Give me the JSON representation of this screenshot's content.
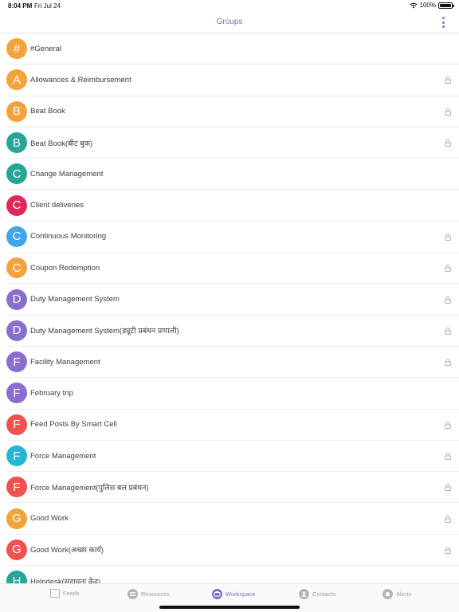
{
  "status_bar": {
    "time": "8:04 PM",
    "date": "Fri Jul 24",
    "battery": "100%"
  },
  "nav": {
    "title": "Groups",
    "more_icon": "vertical-ellipsis-icon"
  },
  "groups": [
    {
      "initial": "#",
      "name": "#General",
      "color": "#f2a33c",
      "locked": false
    },
    {
      "initial": "A",
      "name": "Allowances & Reimbursement",
      "color": "#f2a33c",
      "locked": true
    },
    {
      "initial": "B",
      "name": "Beat Book",
      "color": "#f2a33c",
      "locked": true
    },
    {
      "initial": "B",
      "name": "Beat Book(बीट बुक)",
      "color": "#27a596",
      "locked": true
    },
    {
      "initial": "C",
      "name": "Change Management",
      "color": "#27a596",
      "locked": false
    },
    {
      "initial": "C",
      "name": "Client deliveries",
      "color": "#e0295a",
      "locked": false
    },
    {
      "initial": "C",
      "name": "Continuous Monitoring",
      "color": "#42a4ea",
      "locked": true
    },
    {
      "initial": "C",
      "name": "Coupon Redemption",
      "color": "#f2a33c",
      "locked": true
    },
    {
      "initial": "D",
      "name": "Duty Management System",
      "color": "#8a6ecf",
      "locked": true
    },
    {
      "initial": "D",
      "name": "Duty Management System(ड्यूटी प्रबंधन प्रणाली)",
      "color": "#8a6ecf",
      "locked": true
    },
    {
      "initial": "F",
      "name": "Facility Management",
      "color": "#8a6ecf",
      "locked": true
    },
    {
      "initial": "F",
      "name": "February trip",
      "color": "#8a6ecf",
      "locked": false
    },
    {
      "initial": "F",
      "name": "Feed Posts By Smart Cell",
      "color": "#ef5350",
      "locked": true
    },
    {
      "initial": "F",
      "name": "Force Management",
      "color": "#22b8d3",
      "locked": true
    },
    {
      "initial": "F",
      "name": "Force Management(पुलिस बल प्रबंधन)",
      "color": "#ef5350",
      "locked": true
    },
    {
      "initial": "G",
      "name": "Good Work",
      "color": "#f2a33c",
      "locked": true
    },
    {
      "initial": "G",
      "name": "Good Work(अच्छा कार्य)",
      "color": "#ef5350",
      "locked": true
    },
    {
      "initial": "H",
      "name": "Helpdesk(सहायता केंद्र)",
      "color": "#27a596",
      "locked": false
    }
  ],
  "tabs": [
    {
      "label": "Feeds",
      "icon": "feeds-icon",
      "active": false
    },
    {
      "label": "Resources",
      "icon": "resources-icon",
      "active": false
    },
    {
      "label": "Workspace",
      "icon": "workspace-icon",
      "active": true
    },
    {
      "label": "Contacts",
      "icon": "contacts-icon",
      "active": false
    },
    {
      "label": "Alerts",
      "icon": "alerts-icon",
      "active": false
    }
  ],
  "colors": {
    "accent": "#7b6fc5",
    "inactive": "#9a9aa6",
    "divider": "#ececef"
  }
}
